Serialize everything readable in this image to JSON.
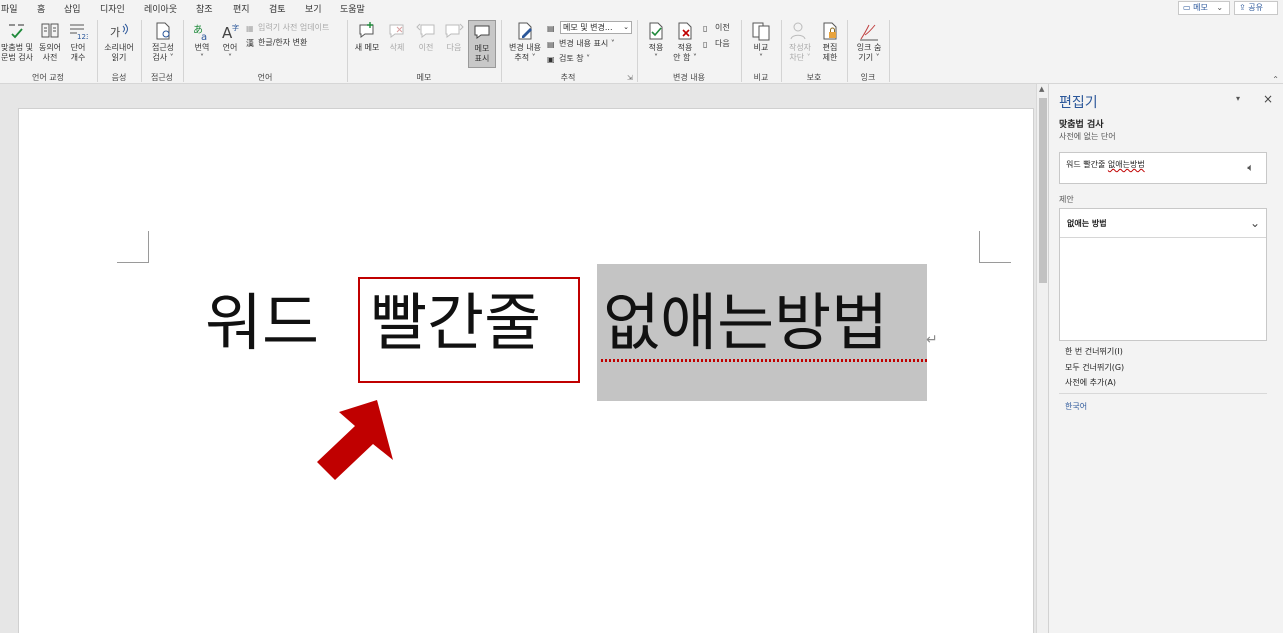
{
  "tabs": [
    "파일",
    "홈",
    "삽입",
    "디자인",
    "레이아웃",
    "참조",
    "편지",
    "검토",
    "보기",
    "도움말"
  ],
  "active_tab": "검토",
  "top_right": {
    "memo": "메모",
    "share": "공유"
  },
  "ribbon": {
    "groups": {
      "proofing": "언어 교정",
      "speech": "음성",
      "accessibility": "접근성",
      "language": "언어",
      "comments": "메모",
      "tracking": "추적",
      "changes": "변경 내용",
      "compare": "비교",
      "protect": "보호",
      "ink": "잉크"
    },
    "buttons": {
      "spelling_1": "맞춤법 및",
      "spelling_2": "문법 검사",
      "thesaurus_1": "동의어",
      "thesaurus_2": "사전",
      "wordcount_1": "단어",
      "wordcount_2": "개수",
      "readaloud_1": "소리내어",
      "readaloud_2": "읽기",
      "access_1": "접근성",
      "access_2": "검사 ˅",
      "translate_1": "번역",
      "translate_2": "˅",
      "language_1": "언어",
      "language_2": "˅",
      "update_dict": "입력기 사전 업데이트",
      "hanja": "한글/한자 변환",
      "new_comment": "새 메모",
      "delete": "삭제",
      "prev": "이전",
      "next": "다음",
      "show_comments_1": "메모",
      "show_comments_2": "표시",
      "track_1": "변경 내용",
      "track_2": "추적 ˅",
      "markup_dd": "메모 및 변경...",
      "show_markup": "변경 내용 표시 ˅",
      "review_pane": "검토 창 ˅",
      "accept_1": "적용",
      "accept_2": "˅",
      "reject_1": "적용",
      "reject_2": "안 함 ˅",
      "change_prev": "이전",
      "change_next": "다음",
      "compare_1": "비교",
      "compare_2": "˅",
      "block_1": "작성자",
      "block_2": "차단 ˅",
      "restrict_1": "편집",
      "restrict_2": "제한",
      "ink_1": "잉크 숨",
      "ink_2": "기기 ˅"
    }
  },
  "document": {
    "word1": "워드",
    "word2": "빨간줄",
    "word3": "없애는방법"
  },
  "editor": {
    "title": "편집기",
    "subtitle": "맞춤법 검사",
    "issue_type": "사전에 없는 단어",
    "context_prefix": "워드 빨간줄 ",
    "context_error": "없애는방법",
    "suggestion_label": "제안",
    "suggestion": "없애는 방법",
    "ignore_once": "한 번 건너뛰기(I)",
    "ignore_all": "모두 건너뛰기(G)",
    "add_dict": "사전에 추가(A)",
    "language": "한국어"
  },
  "colors": {
    "accent": "#2b579a",
    "error": "#c00000"
  }
}
